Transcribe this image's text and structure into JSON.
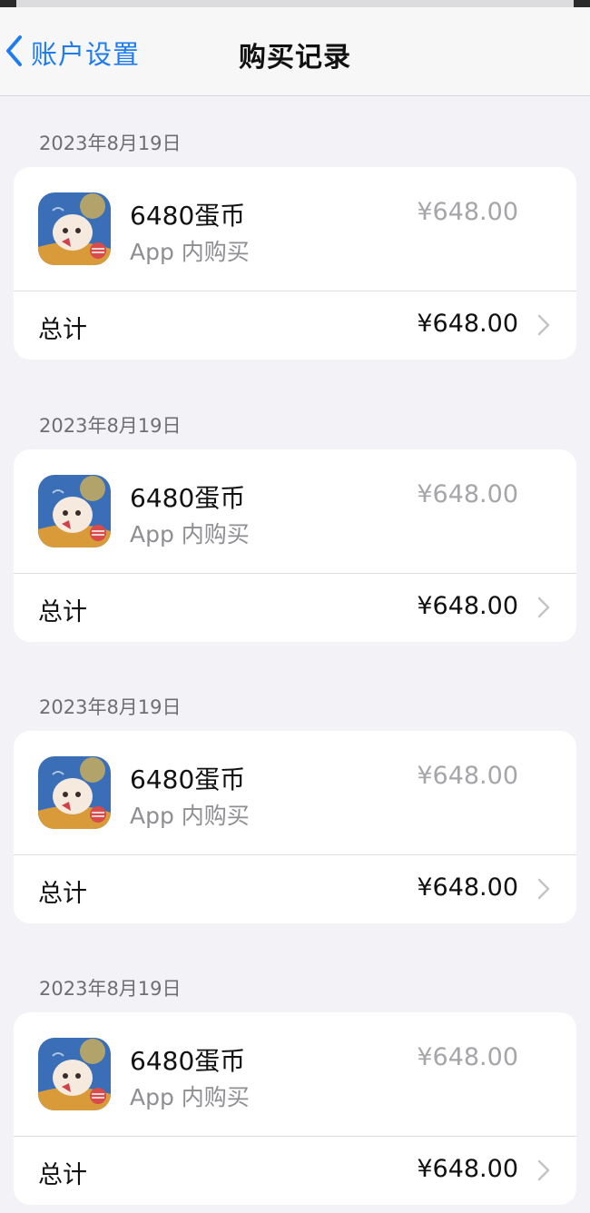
{
  "navbar": {
    "back_label": "账户设置",
    "title": "购买记录"
  },
  "purchases": [
    {
      "date": "2023年8月19日",
      "item_title": "6480蛋币",
      "item_subtitle": "App 内购买",
      "item_price": "¥648.00",
      "total_label": "总计",
      "total_value": "¥648.00",
      "icon": "game-app-icon"
    },
    {
      "date": "2023年8月19日",
      "item_title": "6480蛋币",
      "item_subtitle": "App 内购买",
      "item_price": "¥648.00",
      "total_label": "总计",
      "total_value": "¥648.00",
      "icon": "game-app-icon"
    },
    {
      "date": "2023年8月19日",
      "item_title": "6480蛋币",
      "item_subtitle": "App 内购买",
      "item_price": "¥648.00",
      "total_label": "总计",
      "total_value": "¥648.00",
      "icon": "game-app-icon"
    },
    {
      "date": "2023年8月19日",
      "item_title": "6480蛋币",
      "item_subtitle": "App 内购买",
      "item_price": "¥648.00",
      "total_label": "总计",
      "total_value": "¥648.00",
      "icon": "game-app-icon"
    }
  ],
  "colors": {
    "accent": "#1f7cf0",
    "background": "#f2f2f7",
    "card": "#ffffff",
    "secondary_text": "#8e8e93"
  }
}
